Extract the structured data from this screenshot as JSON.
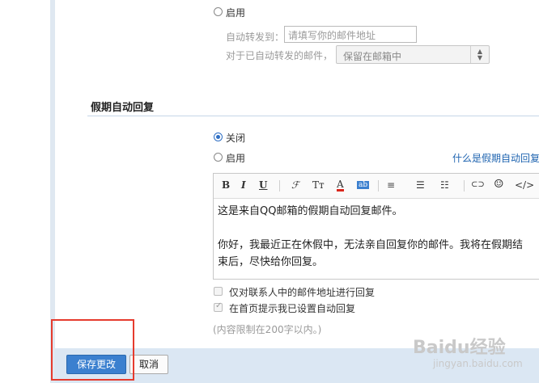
{
  "forward": {
    "enable_label": "启用",
    "forward_to_label": "自动转发到：",
    "forward_to_placeholder": "请填写你的邮件地址",
    "after_forward_label": "对于已自动转发的邮件，",
    "after_forward_value": "保留在邮箱中"
  },
  "vacation": {
    "section_title": "假期自动回复",
    "off_label": "关闭",
    "on_label": "启用",
    "help_link": "什么是假期自动回复",
    "toolbar": {
      "bold": "B",
      "italic": "I",
      "underline": "U",
      "font": "ℱ",
      "font_size": "Tт",
      "text_color": "A",
      "bg_color": "ab",
      "align": "≡",
      "list_bullet": "☰",
      "list_number": "☷",
      "link": "⊂⊃",
      "emoji": "☺",
      "code": "</>"
    },
    "message_line1": "这是来自QQ邮箱的假期自动回复邮件。",
    "message_line2": "你好，我最近正在休假中，无法亲自回复你的邮件。我将在假期结",
    "message_line3": "束后，尽快给你回复。",
    "contacts_only_label": "仅对联系人中的邮件地址进行回复",
    "homepage_notice_label": "在首页提示我已设置自动回复",
    "limit_hint": "(内容限制在200字以内。)"
  },
  "footer": {
    "save_label": "保存更改",
    "cancel_label": "取消"
  },
  "watermark": {
    "brand": "Baidu经验",
    "url": "jingyan.baidu.com"
  },
  "colors": {
    "primary_button": "#3b80cf",
    "link": "#1f64b0",
    "highlight_box": "#e63b2e",
    "footer_bar": "#dbe7f3"
  }
}
